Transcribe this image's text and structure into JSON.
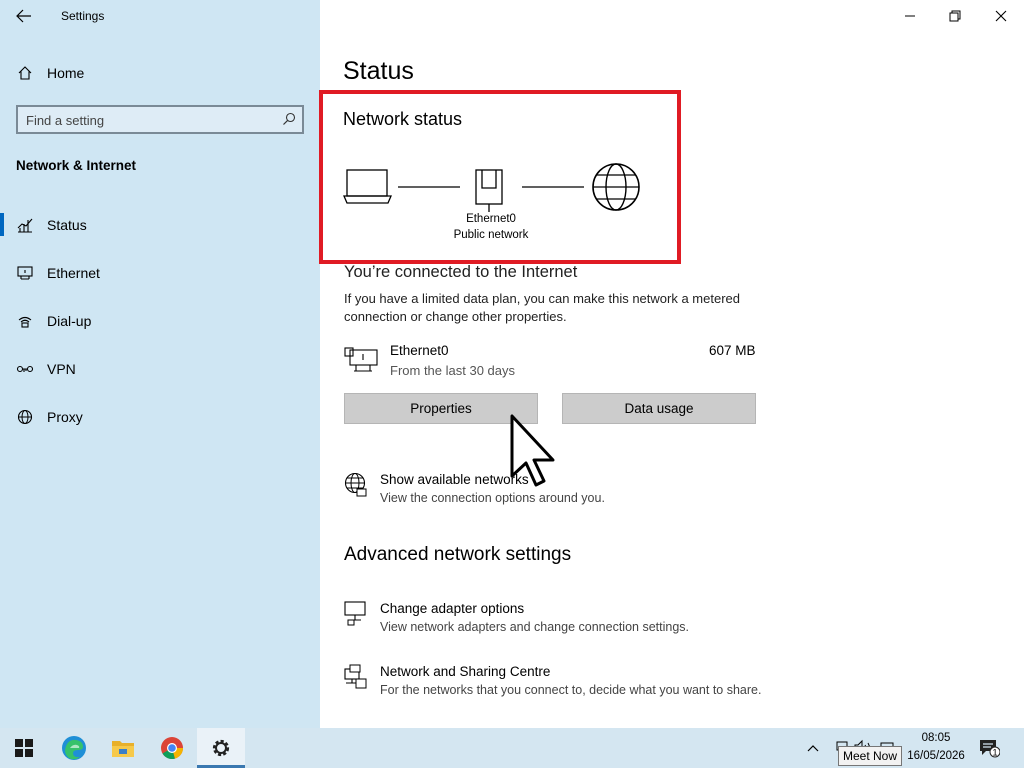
{
  "window": {
    "title": "Settings",
    "minimize_icon": "minimize-icon",
    "maximize_icon": "restore-icon",
    "close_icon": "close-icon"
  },
  "sidebar": {
    "home_label": "Home",
    "search": {
      "placeholder": "Find a setting"
    },
    "section_title": "Network & Internet",
    "items": [
      {
        "label": "Status",
        "icon": "status-icon",
        "active": true
      },
      {
        "label": "Ethernet",
        "icon": "ethernet-icon"
      },
      {
        "label": "Dial-up",
        "icon": "dialup-icon"
      },
      {
        "label": "VPN",
        "icon": "vpn-icon"
      },
      {
        "label": "Proxy",
        "icon": "proxy-icon"
      }
    ]
  },
  "main": {
    "page_title": "Status",
    "network_status": {
      "heading": "Network status",
      "adapter_name": "Ethernet0",
      "network_profile": "Public network"
    },
    "connection": {
      "heading": "You’re connected to the Internet",
      "description": "If you have a limited data plan, you can make this network a metered connection or change other properties.",
      "adapter": "Ethernet0",
      "period": "From the last 30 days",
      "usage": "607 MB",
      "properties_label": "Properties",
      "data_usage_label": "Data usage"
    },
    "show_networks": {
      "title": "Show available networks",
      "description": "View the connection options around you."
    },
    "advanced_heading": "Advanced network settings",
    "adapter_options": {
      "title": "Change adapter options",
      "description": "View network adapters and change connection settings."
    },
    "sharing_centre": {
      "title": "Network and Sharing Centre",
      "description": "For the networks that you connect to, decide what you want to share."
    }
  },
  "taskbar": {
    "apps": [
      "start",
      "edge",
      "file-explorer",
      "chrome",
      "settings"
    ],
    "clock_time": "08:05",
    "clock_date": "16/05/2026",
    "tooltip": "Meet Now",
    "notification_count": "1"
  },
  "colors": {
    "sidebar_bg": "#cfe6f3",
    "accent": "#0067c0",
    "highlight_border": "#e01b24",
    "button_bg": "#cccccc",
    "taskbar_bg": "#d4e6f1"
  }
}
